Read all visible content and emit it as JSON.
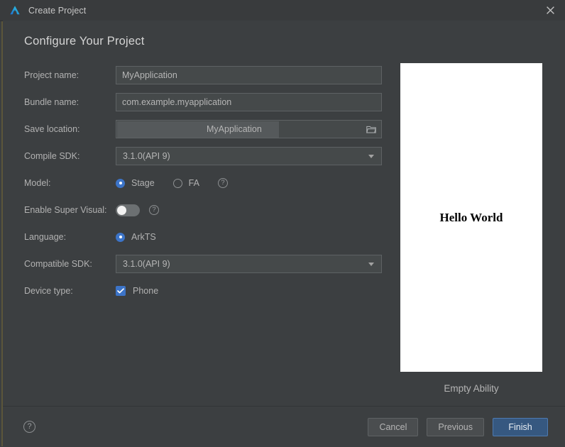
{
  "window": {
    "title": "Create Project",
    "logo_icon": "deveco-logo-icon",
    "close_icon": "close-icon"
  },
  "page": {
    "title": "Configure Your Project"
  },
  "form": {
    "project_name": {
      "label": "Project name:",
      "value": "MyApplication",
      "placeholder": "MyApplication"
    },
    "bundle_name": {
      "label": "Bundle name:",
      "value": "com.example.myapplication",
      "placeholder": "com.example.myapplication"
    },
    "save_location": {
      "label": "Save location:",
      "value": "MyApplication",
      "browse_icon": "folder-open-icon"
    },
    "compile_sdk": {
      "label": "Compile SDK:",
      "value": "3.1.0(API 9)",
      "options": [
        "3.1.0(API 9)"
      ]
    },
    "model": {
      "label": "Model:",
      "selected": "Stage",
      "options": [
        {
          "label": "Stage",
          "checked": true
        },
        {
          "label": "FA",
          "checked": false
        }
      ],
      "help_icon": "help-circle-icon",
      "help_label": "?"
    },
    "enable_super_visual": {
      "label": "Enable Super Visual:",
      "checked": false,
      "help_icon": "help-circle-icon",
      "help_label": "?"
    },
    "language": {
      "label": "Language:",
      "selected": "ArkTS",
      "options": [
        {
          "label": "ArkTS",
          "checked": true
        }
      ]
    },
    "compatible_sdk": {
      "label": "Compatible SDK:",
      "value": "3.1.0(API 9)",
      "options": [
        "3.1.0(API 9)"
      ]
    },
    "device_type": {
      "label": "Device type:",
      "options": [
        {
          "label": "Phone",
          "checked": true
        }
      ]
    }
  },
  "preview": {
    "screen_text": "Hello World",
    "caption": "Empty Ability"
  },
  "footer": {
    "help_icon": "help-circle-icon",
    "help_label": "?",
    "cancel_label": "Cancel",
    "previous_label": "Previous",
    "finish_label": "Finish"
  },
  "colors": {
    "window_bg": "#3c3f41",
    "titlebar_bg": "#393b3d",
    "accent_blue": "#3c74c8",
    "primary_button_bg": "#365880",
    "field_bg": "#45494a",
    "field_border": "#5e6264",
    "left_accent": "#5c563a"
  }
}
